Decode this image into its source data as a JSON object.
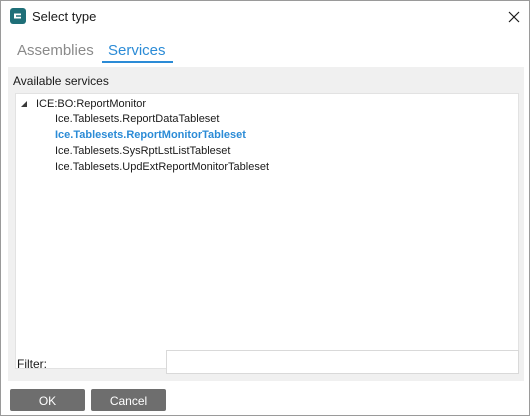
{
  "window": {
    "title": "Select type",
    "app_icon": "epicor-logo-icon",
    "close_icon": "close-icon"
  },
  "tabs": [
    {
      "label": "Assemblies",
      "active": false
    },
    {
      "label": "Services",
      "active": true
    }
  ],
  "services_panel": {
    "label": "Available services",
    "tree": {
      "root": {
        "label": "ICE:BO:ReportMonitor",
        "expanded": true,
        "toggle_icon": "expanded-triangle-icon"
      },
      "children": [
        {
          "label": "Ice.Tablesets.ReportDataTableset",
          "selected": false
        },
        {
          "label": "Ice.Tablesets.ReportMonitorTableset",
          "selected": true
        },
        {
          "label": "Ice.Tablesets.SysRptLstListTableset",
          "selected": false
        },
        {
          "label": "Ice.Tablesets.UpdExtReportMonitorTableset",
          "selected": false
        }
      ]
    },
    "filter": {
      "label": "Filter:",
      "value": "",
      "placeholder": ""
    }
  },
  "buttons": {
    "ok_label": "OK",
    "cancel_label": "Cancel"
  },
  "colors": {
    "accent": "#2b8bd6",
    "button_bg": "#6e6e6e",
    "panel_bg": "#f0f0f0",
    "app_icon_bg": "#1f6f78"
  }
}
